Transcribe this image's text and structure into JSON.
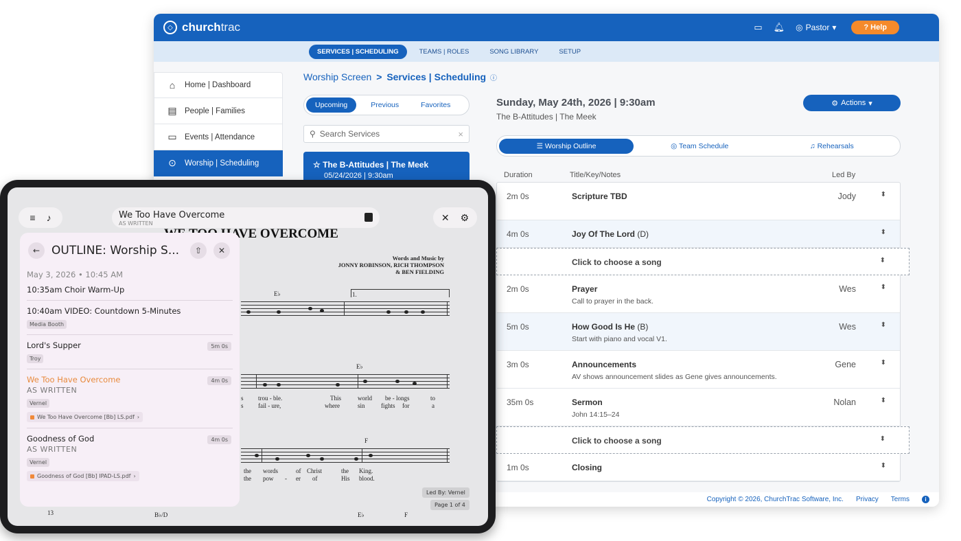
{
  "app": {
    "logo": {
      "bold": "church",
      "light": "trac"
    },
    "topbar": {
      "calendar_icon": "calendar-icon",
      "bell_icon": "bell-icon",
      "user": "Pastor",
      "help": "Help"
    },
    "subnav": [
      "SERVICES | SCHEDULING",
      "TEAMS | ROLES",
      "SONG LIBRARY",
      "SETUP"
    ],
    "sidebar": [
      {
        "label": "Home | Dashboard",
        "icon": "⌂"
      },
      {
        "label": "People | Families",
        "icon": "▤"
      },
      {
        "label": "Events | Attendance",
        "icon": "▭"
      },
      {
        "label": "Worship | Scheduling",
        "icon": "⊙"
      }
    ],
    "breadcrumb": {
      "part1": "Worship Screen",
      "sep": ">",
      "part2": "Services | Scheduling"
    },
    "list_tabs": [
      "Upcoming",
      "Previous",
      "Favorites"
    ],
    "search_placeholder": "Search Services",
    "selected_service": {
      "title": "The B-Attitudes | The Meek",
      "date": "05/24/2026 | 9:30am"
    },
    "detail": {
      "title": "Sunday, May 24th, 2026 | 9:30am",
      "subtitle": "The B-Attitudes | The Meek",
      "actions": "Actions"
    },
    "view_tabs": [
      "Worship Outline",
      "Team Schedule",
      "Rehearsals"
    ],
    "columns": {
      "duration": "Duration",
      "title": "Title/Key/Notes",
      "led": "Led By"
    },
    "rows": [
      {
        "duration": "2m 0s",
        "title": "Scripture TBD",
        "key": "",
        "note": "",
        "led": "Jody"
      },
      {
        "duration": "4m 0s",
        "title": "Joy Of The Lord",
        "key": "(D)",
        "note": "",
        "led": ""
      },
      {
        "placeholder": "Click to choose a song"
      },
      {
        "duration": "2m 0s",
        "title": "Prayer",
        "key": "",
        "note": "Call to prayer in the back.",
        "led": "Wes"
      },
      {
        "duration": "5m 0s",
        "title": "How Good Is He",
        "key": "(B)",
        "note": "Start with piano and vocal V1.",
        "led": "Wes"
      },
      {
        "duration": "3m 0s",
        "title": "Announcements",
        "key": "",
        "note": "AV shows announcement slides as Gene gives announcements.",
        "led": "Gene"
      },
      {
        "duration": "35m 0s",
        "title": "Sermon",
        "key": "",
        "note": "John 14:15–24",
        "led": "Nolan"
      },
      {
        "placeholder2": "Click to choose a song"
      },
      {
        "duration": "1m 0s",
        "title": "Closing",
        "key": "",
        "note": "",
        "led": ""
      }
    ],
    "footer": {
      "copyright": "Copyright © 2026, ChurchTrac Software, Inc.",
      "privacy": "Privacy",
      "terms": "Terms"
    }
  },
  "tablet": {
    "song_title": "We Too Have Overcome",
    "song_sub": "AS WRITTEN",
    "sheet_title": "WE TOO HAVE OVERCOME",
    "credits": [
      "Words and Music by",
      "JONNY ROBINSON, RICH THOMPSON",
      "& BEN FIELDING"
    ],
    "chords": [
      "E♭",
      "1.",
      "E♭",
      "F",
      "13",
      "B♭/D",
      "E♭",
      "F"
    ],
    "lyrics1": [
      "s",
      "trou - ble.",
      "This",
      "world",
      "be - longs",
      "to"
    ],
    "lyrics2": [
      "s",
      "fail - ure,",
      "where",
      "sin",
      "fights",
      "for",
      "a"
    ],
    "lyrics3": [
      "the",
      "words",
      "of",
      "Christ",
      "the",
      "King."
    ],
    "lyrics4": [
      "the",
      "pow",
      "-",
      "er",
      "of",
      "His",
      "blood."
    ],
    "led_by": "Led By: Vernel",
    "page": "Page 1 of 4",
    "panel": {
      "title": "OUTLINE: Worship S...",
      "date": "May 3, 2026 • 10:45 AM",
      "items": [
        {
          "name": "10:35am Choir Warm-Up"
        },
        {
          "name": "10:40am VIDEO: Countdown 5-Minutes",
          "tag": "Media Booth"
        },
        {
          "name": "Lord's Supper",
          "tag": "Troy",
          "len": "5m 0s"
        },
        {
          "name": "We Too Have Overcome",
          "sub": "AS WRITTEN",
          "tag": "Vernel",
          "len": "4m 0s",
          "file": "We Too Have Overcome [Bb] LS.pdf"
        },
        {
          "name": "Goodness of God",
          "sub": "AS WRITTEN",
          "tag": "Vernel",
          "len": "4m 0s",
          "file": "Goodness of God [Bb] IPAD-LS.pdf"
        }
      ]
    }
  }
}
